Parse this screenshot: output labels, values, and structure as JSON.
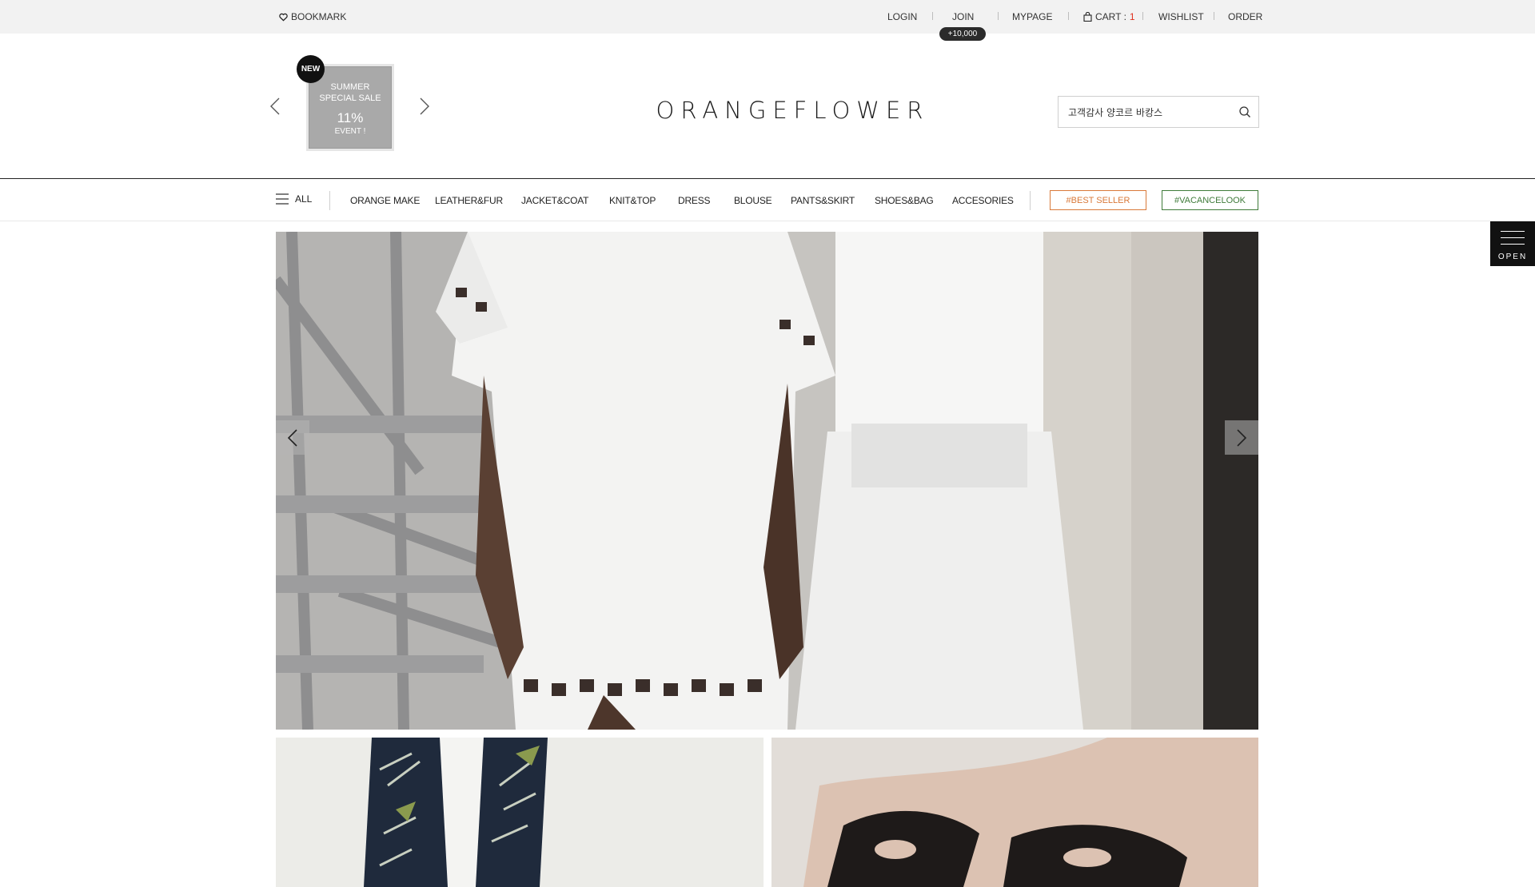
{
  "topbar": {
    "bookmark": "BOOKMARK",
    "login": "LOGIN",
    "join": "JOIN",
    "join_badge": "+10,000",
    "mypage": "MYPAGE",
    "cart_label": "CART : ",
    "cart_count": "1",
    "wishlist": "WISHLIST",
    "order": "ORDER"
  },
  "promo": {
    "badge": "NEW",
    "line1": "SUMMER",
    "line2": "SPECIAL SALE",
    "percent": "11%",
    "event": "EVENT !"
  },
  "logo": "ORANGEFLOWER",
  "search": {
    "value": "고객감사 양코르 바캉스"
  },
  "nav": {
    "all": "ALL",
    "items": [
      "ORANGE MAKE",
      "LEATHER&FUR",
      "JACKET&COAT",
      "KNIT&TOP",
      "DRESS",
      "BLOUSE",
      "PANTS&SKIRT",
      "SHOES&BAG",
      "ACCESORIES"
    ],
    "best_seller": "#BEST SELLER",
    "vacance": "#VACANCELOOK"
  },
  "side_panel": {
    "label": "OPEN"
  },
  "colors": {
    "accent_orange": "#d9793a",
    "accent_green": "#3f7b3a",
    "cart_red": "#e0301e",
    "topbar_bg": "#f2f2f2"
  },
  "icons": [
    "heart-icon",
    "cart-bag-icon",
    "chevron-left-icon",
    "chevron-right-icon",
    "search-icon",
    "hamburger-icon"
  ]
}
